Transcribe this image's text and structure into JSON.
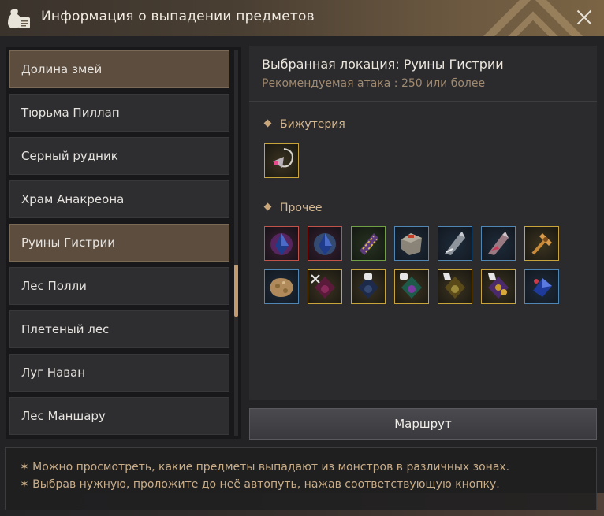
{
  "window": {
    "title": "Информация о выпадении предметов",
    "title_icon": "loot-bag-icon",
    "close_icon": "close-icon"
  },
  "locations": [
    {
      "label": "Долина змей",
      "active": true
    },
    {
      "label": "Тюрьма Пиллап",
      "active": false
    },
    {
      "label": "Серный рудник",
      "active": false
    },
    {
      "label": "Храм Анакреона",
      "active": false
    },
    {
      "label": "Руины Гистрии",
      "active": true
    },
    {
      "label": "Лес Полли",
      "active": false
    },
    {
      "label": "Плетеный лес",
      "active": false
    },
    {
      "label": "Луг Наван",
      "active": false
    },
    {
      "label": "Лес Маншару",
      "active": false
    }
  ],
  "details": {
    "selected_location": "Выбранная локация: Руины Гистрии",
    "recommended_attack": "Рекомендуемая атака : 250 или более",
    "categories": [
      {
        "label": "Бижутерия",
        "items": [
          {
            "icon": "earring-icon",
            "grade": "gold"
          }
        ]
      },
      {
        "label": "Прочее",
        "items": [
          {
            "icon": "red-crystal-icon",
            "grade": "red"
          },
          {
            "icon": "red-crystal-icon",
            "grade": "red"
          },
          {
            "icon": "scroll-icon",
            "grade": "green"
          },
          {
            "icon": "stone-icon",
            "grade": "blue"
          },
          {
            "icon": "arrowhead-icon",
            "grade": "blue"
          },
          {
            "icon": "red-arrowhead-icon",
            "grade": "blue"
          },
          {
            "icon": "hammer-icon",
            "grade": "gold"
          },
          {
            "icon": "ore-icon",
            "grade": "blue"
          },
          {
            "icon": "weapon-box-icon",
            "grade": "gold"
          },
          {
            "icon": "armor-box-icon",
            "grade": "gold"
          },
          {
            "icon": "armor-box-green-icon",
            "grade": "gold"
          },
          {
            "icon": "glove-box-icon",
            "grade": "gold"
          },
          {
            "icon": "accessory-box-icon",
            "grade": "gold"
          },
          {
            "icon": "blue-crystal-icon",
            "grade": "blue"
          }
        ]
      }
    ]
  },
  "route_button": "Маршрут",
  "info": [
    "✶ Можно просмотреть, какие предметы выпадают из монстров в различных зонах.",
    "✶ Выбрав нужную, проложите до неё автопуть, нажав соответствующую кнопку."
  ],
  "colors": {
    "accent": "#c9a77a",
    "active_item": "#5c4d3e",
    "grade_gold": "#c9a43a",
    "grade_red": "#c0524a",
    "grade_blue": "#4f86b4",
    "grade_green": "#6fa046"
  }
}
